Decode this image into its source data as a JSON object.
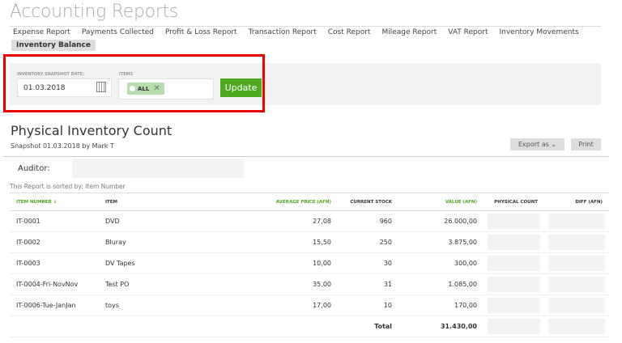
{
  "header": {
    "title": "Accounting Reports"
  },
  "tabs": [
    "Expense Report",
    "Payments Collected",
    "Profit & Loss Report",
    "Transaction Report",
    "Cost Report",
    "Mileage Report",
    "VAT Report",
    "Inventory Movements"
  ],
  "active_tab": "Inventory Balance",
  "filters": {
    "date_label": "INVENTORY SNAPSHOT DATE:",
    "date_value": "01.03.2018",
    "items_label": "ITEMS",
    "items_chip": "ALL",
    "update_label": "Update"
  },
  "report": {
    "title": "Physical Inventory Count",
    "snapshot": "Snapshot 01.03.2018 by Mark T",
    "export_label": "Export as",
    "print_label": "Print",
    "auditor_label": "Auditor:",
    "sorted_by": "This Report is sorted by: Item Number"
  },
  "table": {
    "headers": [
      "ITEM NUMBER ↓",
      "ITEM",
      "AVERAGE PRICE (AFN)",
      "CURRENT STOCK",
      "VALUE (AFN)",
      "PHYSICAL COUNT",
      "DIFF (AFN)"
    ],
    "rows": [
      [
        "IT-0001",
        "DVD",
        "27,08",
        "960",
        "26.000,00"
      ],
      [
        "IT-0002",
        "Bluray",
        "15,50",
        "250",
        "3.875,00"
      ],
      [
        "IT-0003",
        "DV Tapes",
        "10,00",
        "30",
        "300,00"
      ],
      [
        "IT-0004-Fri-NovNov",
        "Test PO",
        "35,00",
        "31",
        "1.085,00"
      ],
      [
        "IT-0006-Tue-JanJan",
        "toys",
        "17,00",
        "10",
        "170,00"
      ]
    ],
    "total_label": "Total",
    "total_value": "31.430,00"
  },
  "colors": {
    "accent": "#4daa1e",
    "highlight": "#ee0000"
  }
}
